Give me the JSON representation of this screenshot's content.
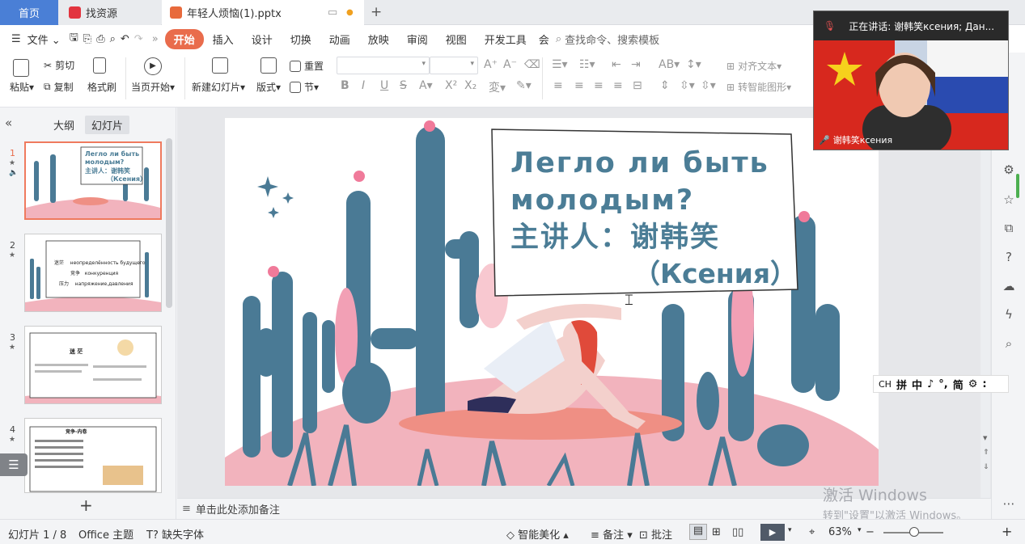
{
  "tabs": {
    "home": "首页",
    "resources": "找资源",
    "document": "年轻人烦恼(1).pptx"
  },
  "menu": {
    "file": "文件",
    "items": [
      "开始",
      "插入",
      "设计",
      "切换",
      "动画",
      "放映",
      "审阅",
      "视图",
      "开发工具",
      "会"
    ],
    "search": "查找命令、搜索模板"
  },
  "ribbon": {
    "paste": "粘贴",
    "cut": "剪切",
    "copy": "复制",
    "format_painter": "格式刷",
    "from_current": "当页开始",
    "new_slide": "新建幻灯片",
    "layout": "版式",
    "reset": "重置",
    "section": "节",
    "align_text": "对齐文本",
    "smart_shape": "转智能图形"
  },
  "panel": {
    "outline_tab": "大纲",
    "slides_tab": "幻灯片"
  },
  "thumbs": [
    {
      "num": "1",
      "title": "Легло ли быть молодым?",
      "sub": "主讲人：谢韩笑",
      "sub2": "（Ксения）"
    },
    {
      "num": "2",
      "l1": "迷茫",
      "l1b": "неопределённость будущего",
      "l2": "竞争",
      "l2b": "конкуренция",
      "l3": "压力",
      "l3b": "напряжение,давления"
    },
    {
      "num": "3",
      "title": "迷 茫"
    },
    {
      "num": "4",
      "title": "竞争-内卷"
    }
  ],
  "slide": {
    "title_line1": "Легло ли быть",
    "title_line2": "молодым?",
    "speaker": "主讲人：谢韩笑",
    "name": "（Ксения）"
  },
  "notes": {
    "placeholder": "单击此处添加备注"
  },
  "status": {
    "slide_counter": "幻灯片 1 / 8",
    "theme": "Office 主题",
    "missing_font": "缺失字体",
    "beautify": "智能美化",
    "notes": "备注",
    "comments": "批注",
    "zoom": "63%"
  },
  "video": {
    "speaking": "正在讲话: 谢韩笑ксения; Дан...",
    "name": "谢韩笑ксения"
  },
  "ime": {
    "items": [
      "CH",
      "拼",
      "中",
      "♪",
      "°,",
      "简",
      "⚙",
      ":"
    ]
  },
  "watermark": {
    "line1": "激活 Windows",
    "line2": "转到\"设置\"以激活 Windows。"
  },
  "colors": {
    "accent": "#e96c4c",
    "home_tab": "#4a7fd6",
    "cactus": "#4a7a95",
    "pink": "#f2b3bd",
    "title_text": "#4b7d96"
  }
}
